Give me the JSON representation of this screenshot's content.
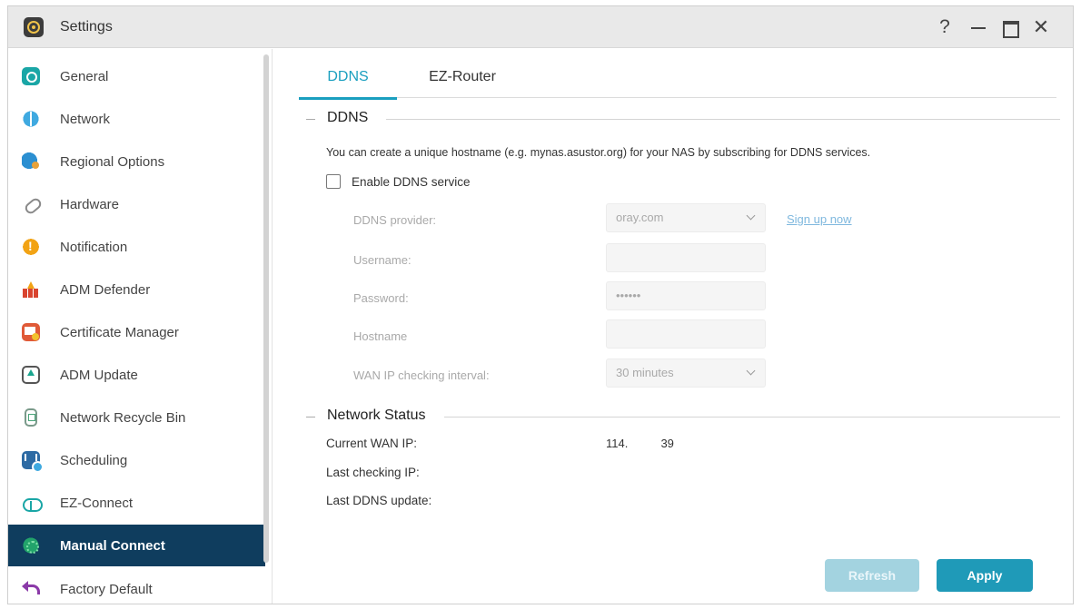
{
  "window": {
    "title": "Settings",
    "help_glyph": "?",
    "close_glyph": "✕"
  },
  "sidebar": {
    "items": [
      {
        "label": "General",
        "icon": "general-icon"
      },
      {
        "label": "Network",
        "icon": "globe-icon"
      },
      {
        "label": "Regional Options",
        "icon": "regional-globe-icon"
      },
      {
        "label": "Hardware",
        "icon": "hardware-icon"
      },
      {
        "label": "Notification",
        "icon": "alert-icon"
      },
      {
        "label": "ADM Defender",
        "icon": "firewall-icon"
      },
      {
        "label": "Certificate Manager",
        "icon": "certificate-icon"
      },
      {
        "label": "ADM Update",
        "icon": "update-icon"
      },
      {
        "label": "Network Recycle Bin",
        "icon": "recycle-bin-icon"
      },
      {
        "label": "Scheduling",
        "icon": "schedule-icon"
      },
      {
        "label": "EZ-Connect",
        "icon": "cloud-upload-icon"
      },
      {
        "label": "Manual Connect",
        "icon": "manual-connect-icon",
        "active": true
      },
      {
        "label": "Factory Default",
        "icon": "undo-arrow-icon"
      }
    ]
  },
  "tabs": [
    {
      "label": "DDNS",
      "active": true
    },
    {
      "label": "EZ-Router",
      "active": false
    }
  ],
  "ddns": {
    "section_title": "DDNS",
    "description": "You can create a unique hostname (e.g. mynas.asustor.org) for your NAS by subscribing for DDNS services.",
    "enable_label": "Enable DDNS service",
    "enabled": false,
    "provider_label": "DDNS provider:",
    "provider_value": "oray.com",
    "signup_link": "Sign up now",
    "username_label": "Username:",
    "username_value": "",
    "password_label": "Password:",
    "password_value": "••••••",
    "hostname_label": "Hostname",
    "hostname_value": "",
    "interval_label": "WAN IP checking interval:",
    "interval_value": "30 minutes"
  },
  "network_status": {
    "section_title": "Network Status",
    "current_wan_ip_label": "Current WAN IP:",
    "current_wan_ip_value": "114.          39",
    "last_checking_ip_label": "Last checking IP:",
    "last_ddns_update_label": "Last DDNS update:"
  },
  "buttons": {
    "refresh": "Refresh",
    "apply": "Apply"
  },
  "colors": {
    "accent": "#1a9fbf",
    "sidebar_active": "#0f3d5e",
    "apply_button": "#1f9ab8",
    "refresh_button_disabled": "#a3d3e0"
  }
}
